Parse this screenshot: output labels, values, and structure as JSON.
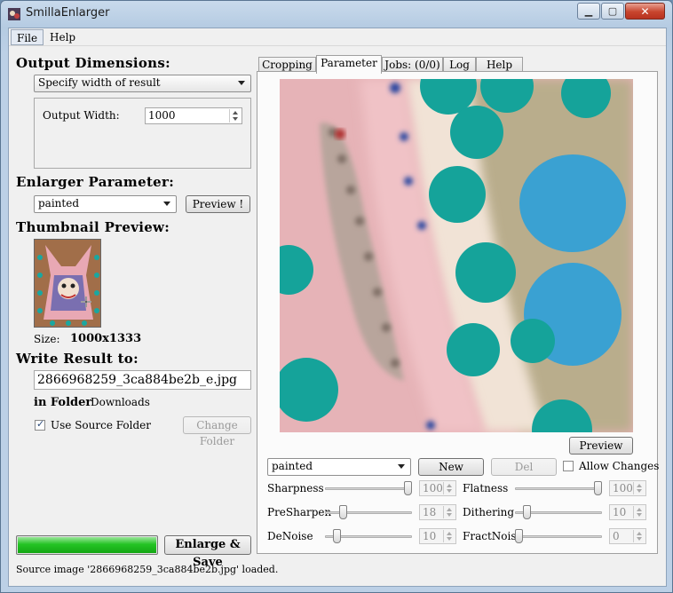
{
  "window": {
    "title": "SmillaEnlarger"
  },
  "menu": {
    "file": "File",
    "help": "Help"
  },
  "output": {
    "heading": "Output Dimensions:",
    "mode": "Specify width of result",
    "width_label": "Output Width:",
    "width_value": "1000"
  },
  "enlarger": {
    "heading": "Enlarger Parameter:",
    "preset": "painted",
    "preview_button": "Preview !"
  },
  "thumbnail": {
    "heading": "Thumbnail Preview:",
    "size_label": "Size:",
    "size_value": "1000x1333"
  },
  "write": {
    "heading": "Write Result to:",
    "filename": "2866968259_3ca884be2b_e.jpg",
    "folder_label": "in Folder",
    "folder_value": "Downloads",
    "use_source_label": "Use Source Folder",
    "use_source_checked": true,
    "change_folder_button": "Change Folder"
  },
  "progress": {
    "fraction": 1.0
  },
  "enlarge_button": "Enlarge & Save",
  "status": "Source image '2866968259_3ca884be2b.jpg' loaded.",
  "tabs": [
    {
      "label": "Cropping",
      "active": false
    },
    {
      "label": "Parameter",
      "active": true
    },
    {
      "label": "Jobs: (0/0)",
      "active": false
    },
    {
      "label": "Log",
      "active": false
    },
    {
      "label": "Help",
      "active": false
    }
  ],
  "param": {
    "preview_button": "Preview",
    "preset": "painted",
    "new_button": "New",
    "del_button": "Del",
    "allow_changes_label": "Allow Changes",
    "allow_changes_checked": false,
    "sliders": [
      {
        "label": "Sharpness",
        "value": "100",
        "fraction": 1.0
      },
      {
        "label": "Flatness",
        "value": "100",
        "fraction": 1.0
      },
      {
        "label": "PreSharpen",
        "value": "18",
        "fraction": 0.18
      },
      {
        "label": "Dithering",
        "value": "10",
        "fraction": 0.1
      },
      {
        "label": "DeNoise",
        "value": "10",
        "fraction": 0.1
      },
      {
        "label": "FractNoise",
        "value": "0",
        "fraction": 0.0
      }
    ]
  },
  "colors": {
    "accent_green": "#24c424",
    "window_frame": "#bcd0e6",
    "close_red": "#c7452e"
  }
}
